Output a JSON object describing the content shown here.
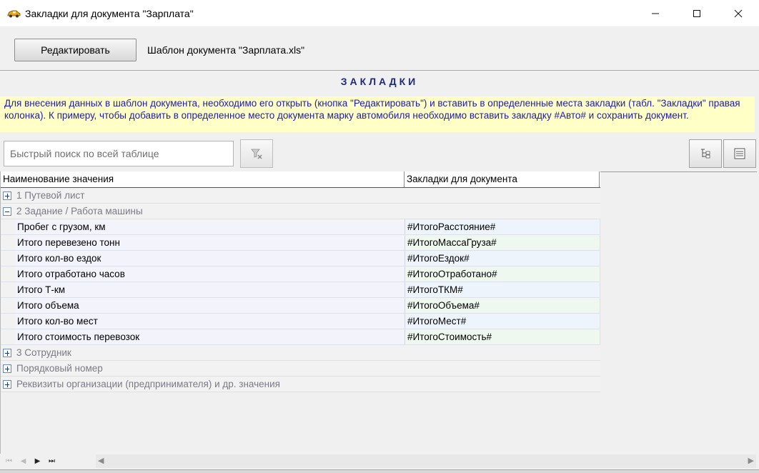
{
  "window": {
    "title": "Закладки для документа \"Зарплата\"",
    "controls": {
      "minimize": "—",
      "maximize": "☐",
      "close": "✕"
    }
  },
  "toolbar": {
    "edit_label": "Редактировать",
    "template_label": "Шаблон документа \"Зарплата.xls\""
  },
  "section": {
    "title": "ЗАКЛАДКИ",
    "info": "Для внесения данных в шаблон документа, необходимо его открыть (кнопка \"Редактировать\") и вставить в определенные места закладки (табл. \"Закладки\" правая колонка). К примеру, чтобы добавить в определенное место документа марку автомобиля необходимо вставить закладку #Авто# и сохранить документ."
  },
  "search": {
    "placeholder": "Быстрый поиск по всей таблице"
  },
  "grid": {
    "columns": [
      "Наименование значения",
      "Закладки для документа"
    ],
    "groups_before": [
      {
        "label": "1 Путевой лист",
        "expanded": false
      }
    ],
    "expanded_group": {
      "label": "2 Задание / Работа машины",
      "expanded": true
    },
    "rows": [
      {
        "name": "Пробег с грузом, км",
        "bookmark": "#ИтогоРасстояние#"
      },
      {
        "name": "Итого перевезено тонн",
        "bookmark": "#ИтогоМассаГруза#"
      },
      {
        "name": "Итого кол-во ездок",
        "bookmark": "#ИтогоЕздок#"
      },
      {
        "name": "Итого отработано часов",
        "bookmark": "#ИтогоОтработано#"
      },
      {
        "name": "Итого Т-км",
        "bookmark": "#ИтогоТКМ#"
      },
      {
        "name": "Итого объема",
        "bookmark": "#ИтогоОбъема#"
      },
      {
        "name": "Итого кол-во мест",
        "bookmark": "#ИтогоМест#"
      },
      {
        "name": "Итого стоимость перевозок",
        "bookmark": "#ИтогоСтоимость#"
      }
    ],
    "groups_after": [
      {
        "label": "3 Сотрудник",
        "expanded": false
      },
      {
        "label": "Порядковый номер",
        "expanded": false
      },
      {
        "label": "Реквизиты организации (предпринимателя) и др. значения",
        "expanded": false
      }
    ]
  },
  "colors": {
    "info_background": "#ffffc6",
    "info_text": "#1c1ca8",
    "section_title": "#1f2a7a"
  }
}
